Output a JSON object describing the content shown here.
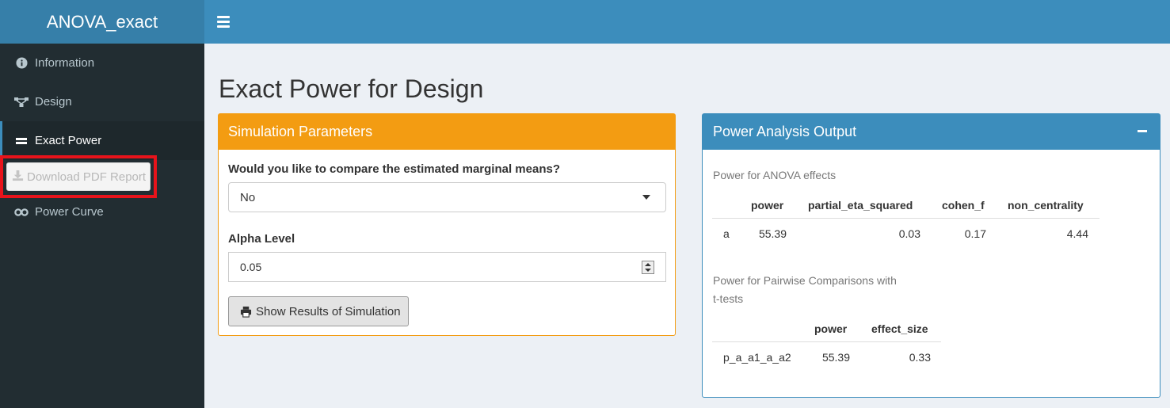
{
  "app": {
    "title": "ANOVA_exact"
  },
  "sidebar": {
    "items": [
      {
        "label": "Information",
        "icon": "info-circle-icon"
      },
      {
        "label": "Design",
        "icon": "sitemap-icon"
      },
      {
        "label": "Exact Power",
        "icon": "equals-icon",
        "active": true
      },
      {
        "label": "Download PDF Report",
        "icon": "download-icon",
        "disabled": true
      },
      {
        "label": "Power Curve",
        "icon": "infinity-icon"
      }
    ]
  },
  "page": {
    "title": "Exact Power for Design"
  },
  "sim_box": {
    "title": "Simulation Parameters",
    "emm_question": "Would you like to compare the estimated marginal means?",
    "emm_value": "No",
    "alpha_label": "Alpha Level",
    "alpha_value": "0.05",
    "button_label": "Show Results of Simulation"
  },
  "output_box": {
    "title": "Power Analysis Output",
    "anova_caption": "Power for ANOVA effects",
    "anova_table": {
      "headers": [
        "",
        "power",
        "partial_eta_squared",
        "cohen_f",
        "non_centrality"
      ],
      "rows": [
        [
          "a",
          "55.39",
          "0.03",
          "0.17",
          "4.44"
        ]
      ]
    },
    "pairwise_caption_line1": "Power for Pairwise Comparisons with",
    "pairwise_caption_line2": "t-tests",
    "pairwise_table": {
      "headers": [
        "",
        "power",
        "effect_size"
      ],
      "rows": [
        [
          "p_a_a1_a_a2",
          "55.39",
          "0.33"
        ]
      ]
    }
  },
  "colors": {
    "header_blue": "#3c8dbc",
    "logo_blue": "#367fa9",
    "warning_orange": "#f39c12",
    "sidebar_dark": "#222d32",
    "highlight_red": "#e8131b"
  }
}
